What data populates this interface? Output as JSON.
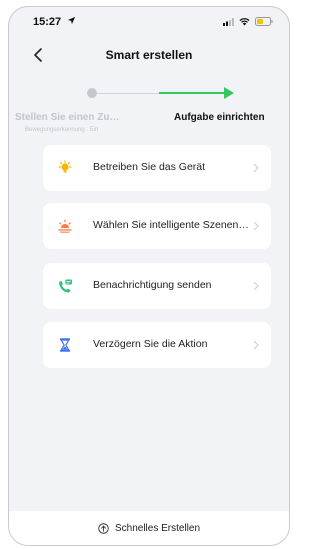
{
  "status_bar": {
    "time": "15:27",
    "icons": [
      "location-arrow-icon",
      "signal-icon",
      "wifi-icon",
      "battery-icon"
    ],
    "battery_color": "#f5c400"
  },
  "header": {
    "title": "Smart erstellen",
    "back_icon": "chevron-left-icon"
  },
  "stepper": {
    "step1_label": "Stellen Sie einen Zu…",
    "step1_sub": "Bewegungserkennung : Ein",
    "step2_label": "Aufgabe einrichten",
    "active_color": "#34c95e",
    "inactive_color": "#c6c8cd"
  },
  "actions": [
    {
      "label": "Betreiben Sie das Gerät",
      "icon": "device-bulb-icon",
      "color": "#f7b500"
    },
    {
      "label": "Wählen Sie intelligente Szenen…",
      "icon": "sunrise-scene-icon",
      "color": "#ff7a45"
    },
    {
      "label": "Benachrichtigung senden",
      "icon": "notification-message-icon",
      "color": "#2fc27a"
    },
    {
      "label": "Verzögern Sie die Aktion",
      "icon": "hourglass-icon",
      "color": "#3a6ff0"
    }
  ],
  "footer": {
    "label": "Schnelles Erstellen",
    "icon": "arrow-up-circle-icon"
  }
}
